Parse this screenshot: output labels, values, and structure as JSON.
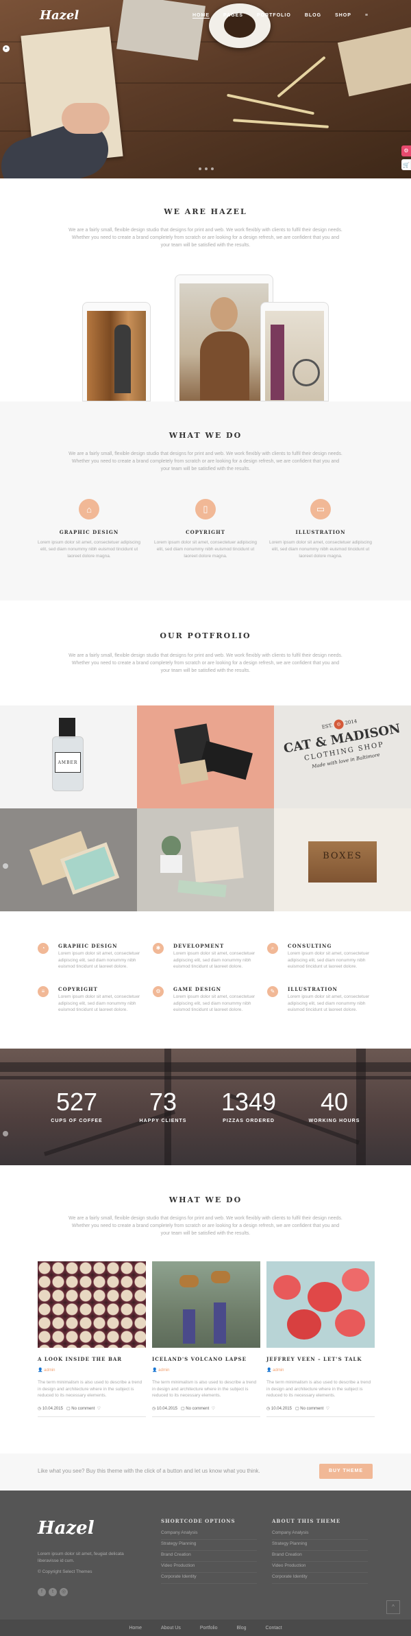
{
  "brand": {
    "logo": "Hazel"
  },
  "nav": {
    "items": [
      "HOME",
      "PAGES",
      "PORTFOLIO",
      "BLOG",
      "SHOP"
    ],
    "menu_icon": "≡"
  },
  "hero": {
    "slide_count": 3
  },
  "about": {
    "title": "WE ARE HAZEL",
    "text": "We are a fairly small, flexible design studio that designs for print and web. We work flexibly with clients to fulfil their design needs. Whether you need to create a brand completely from scratch or are looking for a design refresh, we are confident that you and your team will be satisfied with the results."
  },
  "whatwedo": {
    "title": "WHAT WE DO",
    "text": "We are a fairly small, flexible design studio that designs for print and web. We work flexibly with clients to fulfil their design needs. Whether you need to create a brand completely from scratch or are looking for a design refresh, we are confident that you and your team will be satisfied with the results.",
    "services": [
      {
        "icon": "bag-icon",
        "title": "GRAPHIC DESIGN",
        "text": "Lorem ipsum dolor sit amet, consectetuer adipiscing elit, sed diam nonummy nibh euismod tincidunt ut laoreet dolore magna."
      },
      {
        "icon": "bookmark-icon",
        "title": "COPYRIGHT",
        "text": "Lorem ipsum dolor sit amet, consectetuer adipiscing elit, sed diam nonummy nibh euismod tincidunt ut laoreet dolore magna."
      },
      {
        "icon": "briefcase-icon",
        "title": "ILLUSTRATION",
        "text": "Lorem ipsum dolor sit amet, consectetuer adipiscing elit, sed diam nonummy nibh euismod tincidunt ut laoreet dolore magna."
      }
    ]
  },
  "portfolio": {
    "title": "OUR POTFROLIO",
    "text": "We are a fairly small, flexible design studio that designs for print and web. We work flexibly with clients to fulfil their design needs. Whether you need to create a brand completely from scratch or are looking for a design refresh, we are confident that you and your team will be satisfied with the results.",
    "bottle_label": "AMBER",
    "brand_sign": {
      "est": "EST.",
      "year": "2014",
      "name": "CAT & MADISON",
      "sub": "CLOTHING SHOP",
      "tag": "Made with love in Baltimore"
    },
    "crate_label": "BOXES"
  },
  "features": [
    {
      "title": "GRAPHIC DESIGN",
      "text": "Lorem ipsum dolor sit amet, consectetuer adipiscing elit, sed diam nonummy nibh euismod tincidunt ut laoreet dolore."
    },
    {
      "title": "DEVELOPMENT",
      "text": "Lorem ipsum dolor sit amet, consectetuer adipiscing elit, sed diam nonummy nibh euismod tincidunt ut laoreet dolore."
    },
    {
      "title": "CONSULTING",
      "text": "Lorem ipsum dolor sit amet, consectetuer adipiscing elit, sed diam nonummy nibh euismod tincidunt ut laoreet dolore."
    },
    {
      "title": "COPYRIGHT",
      "text": "Lorem ipsum dolor sit amet, consectetuer adipiscing elit, sed diam nonummy nibh euismod tincidunt ut laoreet dolore."
    },
    {
      "title": "GAME DESIGN",
      "text": "Lorem ipsum dolor sit amet, consectetuer adipiscing elit, sed diam nonummy nibh euismod tincidunt ut laoreet dolore."
    },
    {
      "title": "ILLUSTRATION",
      "text": "Lorem ipsum dolor sit amet, consectetuer adipiscing elit, sed diam nonummy nibh euismod tincidunt ut laoreet dolore."
    }
  ],
  "counters": [
    {
      "value": "527",
      "label": "CUPS OF COFFEE"
    },
    {
      "value": "73",
      "label": "HAPPY CLIENTS"
    },
    {
      "value": "1349",
      "label": "PIZZAS ORDERED"
    },
    {
      "value": "40",
      "label": "WORKING HOURS"
    }
  ],
  "blog": {
    "title": "WHAT WE DO",
    "text": "We are a fairly small, flexible design studio that designs for print and web. We work flexibly with clients to fulfil their design needs. Whether you need to create a brand completely from scratch or are looking for a design refresh, we are confident that you and your team will be satisfied with the results.",
    "posts": [
      {
        "title": "A LOOK INSIDE THE BAR",
        "author": "admin",
        "text": "The term minimalism is also used to describe a trend in design and architecture where in the subject is reduced to its necessary elements.",
        "date": "10.04.2015",
        "comments": "No comment"
      },
      {
        "title": "ICELAND'S VOLCANO LAPSE",
        "author": "admin",
        "text": "The term minimalism is also used to describe a trend in design and architecture where in the subject is reduced to its necessary elements.",
        "date": "10.04.2015",
        "comments": "No comment"
      },
      {
        "title": "JEFFREY VEEN – LET'S TALK",
        "author": "admin",
        "text": "The term minimalism is also used to describe a trend in design and architecture where in the subject is reduced to its necessary elements.",
        "date": "10.04.2015",
        "comments": "No comment"
      }
    ]
  },
  "cta": {
    "text": "Like what you see? Buy this theme with the click of a button and let us know what you think.",
    "button": "BUY THEME"
  },
  "footer": {
    "logo": "Hazel",
    "about_text": "Lorem ipsum dolor sit amet, feugiat delicata liberavisse id cum.",
    "copyright": "© Copyright Select Themes",
    "col1_title": "SHORTCODE OPTIONS",
    "col1_items": [
      "Company Analysis",
      "Strategy Planning",
      "Brand Creation",
      "Video Production",
      "Corporate Identity"
    ],
    "col2_title": "ABOUT THIS THEME",
    "col2_items": [
      "Company Analysis",
      "Strategy Planning",
      "Brand Creation",
      "Video Production",
      "Corporate Identity"
    ],
    "social": [
      "f",
      "t",
      "◎"
    ],
    "bottom_nav": [
      "Home",
      "About Us",
      "Portfolio",
      "Blog",
      "Contact"
    ],
    "totop": "^"
  },
  "colors": {
    "accent": "#f1b896",
    "pink": "#e74a6e",
    "footer": "#555555"
  }
}
